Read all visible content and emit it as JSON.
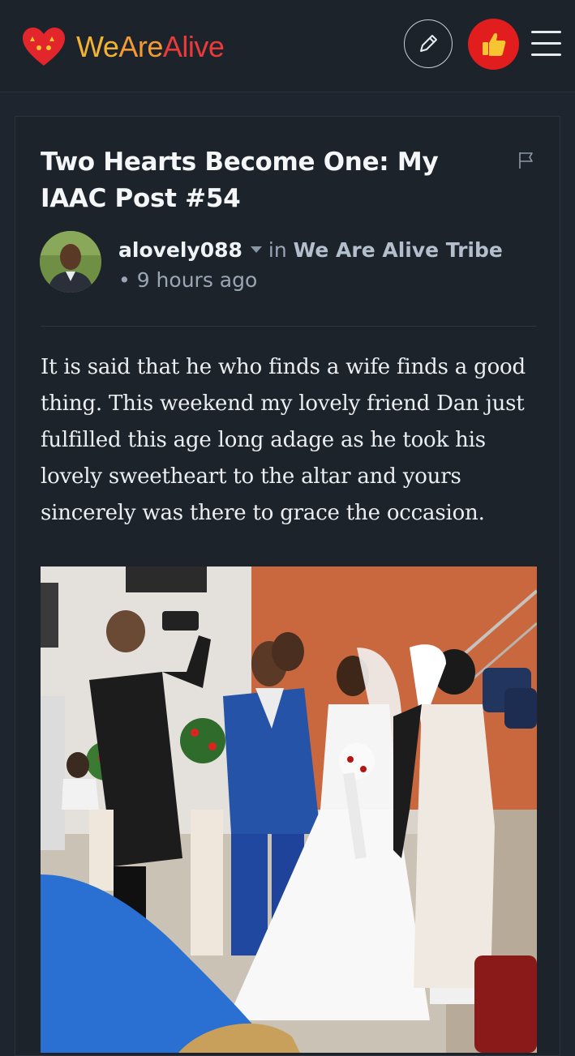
{
  "header": {
    "logo_we": "We",
    "logo_are": "Are",
    "logo_alive": "Alive",
    "edit_icon": "pencil-icon",
    "vote_icon": "thumbs-up-icon",
    "menu_icon": "hamburger-menu-icon"
  },
  "post": {
    "title": "Two Hearts Become One: My IAAC Post #54",
    "author": "alovely088",
    "in_label": "in",
    "community": "We Are Alive Tribe",
    "separator": "•",
    "time": "9 hours ago",
    "body": "It is said that he who finds a wife finds a good thing. This weekend my lovely friend Dan just fulfilled this age long adage as he took his lovely sweetheart to the altar and yours sincerely was there to grace the occasion."
  },
  "colors": {
    "background": "#1f252e",
    "vote_button": "#e21d1d",
    "logo_yellow": "#f4b233",
    "logo_red": "#ea3a3a"
  }
}
